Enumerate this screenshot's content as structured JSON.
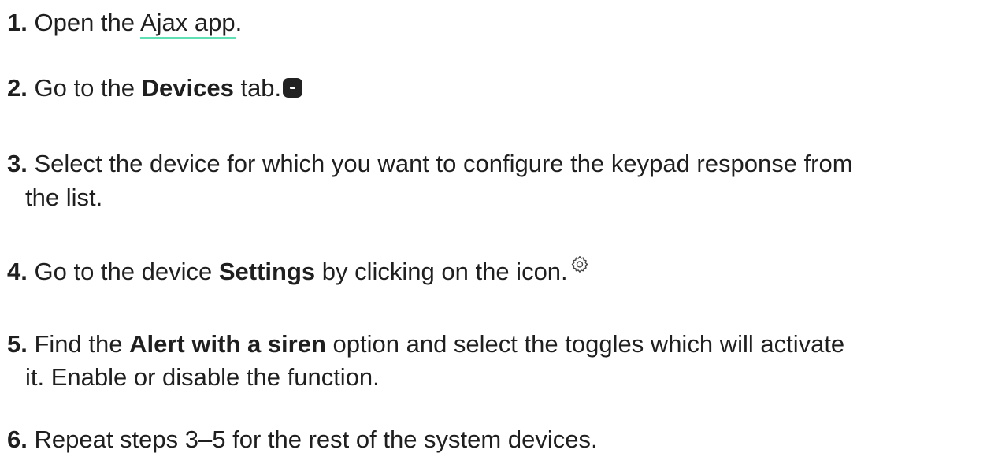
{
  "steps": [
    {
      "num": "1.",
      "pre": "Open the ",
      "link": "Ajax app",
      "post": "."
    },
    {
      "num": "2.",
      "pre": "Go to the ",
      "bold": "Devices",
      "post": " tab.",
      "icon": "devices-tab-icon"
    },
    {
      "num": "3.",
      "line1": "Select the device for which you want to configure the keypad response from",
      "line2": "the list."
    },
    {
      "num": "4.",
      "pre": "Go to the device ",
      "bold": "Settings",
      "post": " by clicking on the icon.",
      "icon": "gear-icon"
    },
    {
      "num": "5.",
      "pre": "Find the ",
      "bold": "Alert with a siren",
      "post": " option and select the toggles which will activate",
      "line2": "it. Enable or disable the function."
    },
    {
      "num": "6.",
      "text": "Repeat steps 3–5 for the rest of the system devices."
    }
  ],
  "colors": {
    "text": "#1f1f1f",
    "link_underline": "#5fe0b4",
    "icon_bg": "#222222"
  }
}
